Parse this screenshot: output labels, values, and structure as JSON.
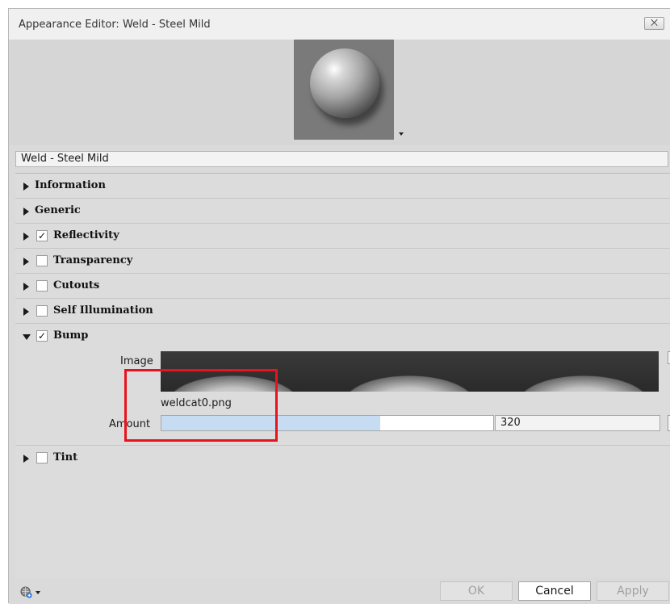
{
  "window": {
    "title": "Appearance Editor: Weld - Steel Mild",
    "close_label": "⨉"
  },
  "appearance_name": "Weld - Steel Mild",
  "sections": {
    "information": "Information",
    "generic": "Generic",
    "reflectivity": "Reflectivity",
    "transparency": "Transparency",
    "cutouts": "Cutouts",
    "self_illumination": "Self Illumination",
    "bump": "Bump",
    "tint": "Tint"
  },
  "checks": {
    "checked_glyph": "✓"
  },
  "bump": {
    "image_label": "Image",
    "filename": "weldcat0.png",
    "amount_label": "Amount",
    "amount_value": "320",
    "amount_fraction": 0.66
  },
  "footer": {
    "ok": "OK",
    "cancel": "Cancel",
    "apply": "Apply"
  },
  "colors": {
    "highlight": "#e8131b",
    "slider_fill": "#c5dcf2"
  }
}
